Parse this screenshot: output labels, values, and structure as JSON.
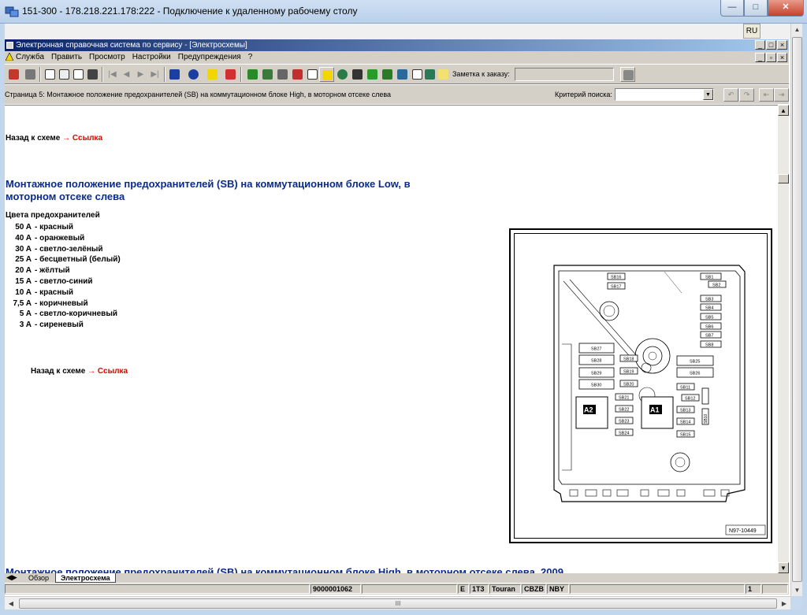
{
  "window": {
    "title": "151-300 - 178.218.221.178:222 - Подключение к удаленному рабочему столу",
    "min": "—",
    "max": "□",
    "close": "✕"
  },
  "remote": {
    "lang": "RU"
  },
  "app": {
    "title": "Электронная справочная система по сервису - [Электросхемы]",
    "menu": [
      "Служба",
      "Править",
      "Просмотр",
      "Настройки",
      "Предупреждения",
      "?"
    ]
  },
  "toolbar": {
    "order_label": "Заметка к заказу:",
    "order_value": ""
  },
  "pagebar": {
    "page_text": "Страница 5: Монтажное положение предохранителей (SB) на коммутационном блоке High, в моторном отсеке слева",
    "criteria_label": "Критерий поиска:",
    "criteria_value": ""
  },
  "content": {
    "back_text": "Назад к схеме",
    "back_link": "→ Ссылка",
    "heading": "Монтажное положение предохранителей (SB) на коммутационном блоке Low, в моторном отсеке слева",
    "colors_title": "Цвета предохранителей",
    "fuses": [
      {
        "amp": "50 A",
        "color": "- красный"
      },
      {
        "amp": "40 A",
        "color": "- оранжевый"
      },
      {
        "amp": "30 A",
        "color": "- светло-зелёный"
      },
      {
        "amp": "25 A",
        "color": "- бесцветный (белый)"
      },
      {
        "amp": "20 A",
        "color": "- жёлтый"
      },
      {
        "amp": "15 A",
        "color": "- светло-синий"
      },
      {
        "amp": "10 A",
        "color": "- красный"
      },
      {
        "amp": "7,5 A",
        "color": "- коричневый"
      },
      {
        "amp": "5 A",
        "color": "- светло-коричневый"
      },
      {
        "amp": "3 A",
        "color": "- сиреневый"
      }
    ],
    "back_text_2": "Назад к схеме",
    "back_link_2": "→ Ссылка",
    "next_heading": "Монтажное положение предохранителей (SB) на коммутационном блоке High, в моторном отсеке слева, 2009"
  },
  "diagram": {
    "code": "N97-10449",
    "labels": {
      "sb1": "SB1",
      "sb2": "SB2",
      "sb3": "SB3",
      "sb4": "SB4",
      "sb5": "SB5",
      "sb6": "SB6",
      "sb7": "SB7",
      "sb8": "SB8",
      "sb10": "SB10",
      "sb11": "SB11",
      "sb12": "SB12",
      "sb13": "SB13",
      "sb14": "SB14",
      "sb15": "SB15",
      "sb16": "SB16",
      "sb17": "SB17",
      "sb18": "SB18",
      "sb19": "SB19",
      "sb20": "SB20",
      "sb21": "SB21",
      "sb22": "SB22",
      "sb23": "SB23",
      "sb24": "SB24",
      "sb25": "SB25",
      "sb26": "SB26",
      "sb27": "SB27",
      "sb28": "SB28",
      "sb29": "SB29",
      "sb30": "SB30",
      "a1": "A1",
      "a2": "A2"
    }
  },
  "tabs": [
    "Обзор",
    "Электросхема"
  ],
  "status": {
    "order": "9000001062",
    "c1": "E",
    "c2": "1T3",
    "c3": "Touran",
    "c4": "CBZB",
    "c5": "NBY",
    "page": "1"
  },
  "hscroll_grip": "III",
  "colors": {
    "heading": "#0a2a8c",
    "link": "#e00000",
    "app_title_start": "#0a246a"
  }
}
